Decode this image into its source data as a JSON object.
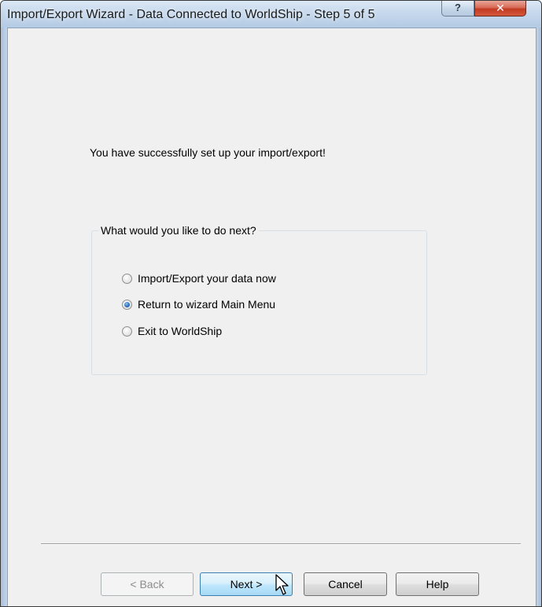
{
  "window": {
    "title": "Import/Export Wizard - Data Connected to WorldShip - Step 5 of 5",
    "help_glyph": "?",
    "close_glyph": "✕"
  },
  "main": {
    "success_message": "You have successfully set up your import/export!",
    "group_label": "What would you like to do next?",
    "options": [
      {
        "label": "Import/Export your data now",
        "selected": false
      },
      {
        "label": "Return to wizard Main Menu",
        "selected": true
      },
      {
        "label": "Exit to WorldShip",
        "selected": false
      }
    ]
  },
  "footer": {
    "back_label": "< Back",
    "next_label": "Next >",
    "cancel_label": "Cancel",
    "help_label": "Help"
  },
  "colors": {
    "dialog_bg": "#f0f0f0",
    "radio_selected": "#2a6ab8",
    "default_button_border": "#3c7fb1"
  }
}
